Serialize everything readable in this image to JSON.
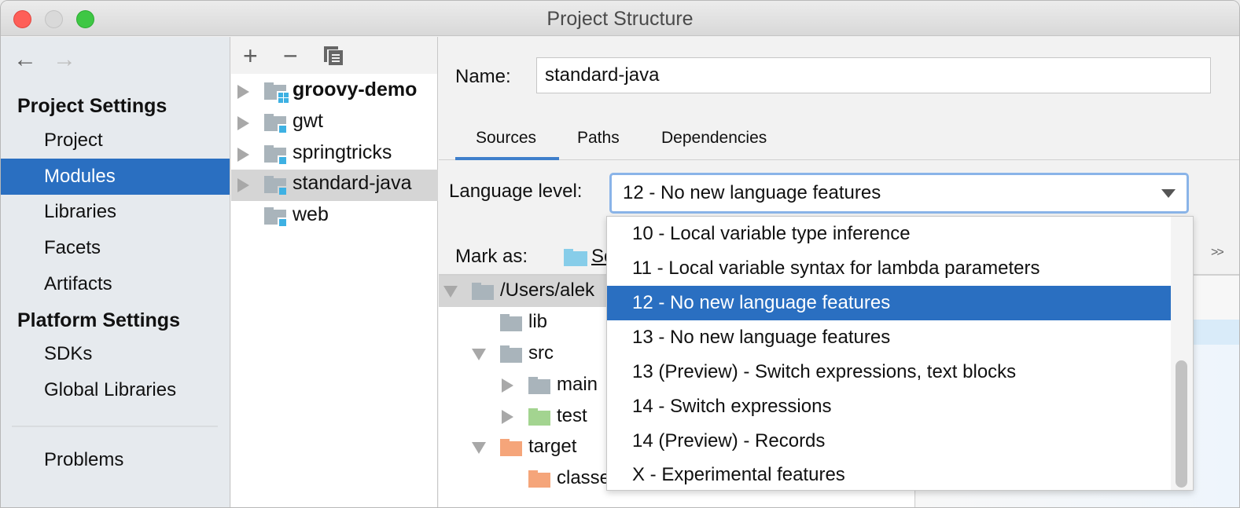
{
  "window": {
    "title": "Project Structure"
  },
  "sidebar": {
    "back_icon": "arrow-left-icon",
    "forward_icon": "arrow-right-icon",
    "sections": [
      {
        "heading": "Project Settings",
        "items": [
          {
            "label": "Project",
            "selected": false
          },
          {
            "label": "Modules",
            "selected": true
          },
          {
            "label": "Libraries",
            "selected": false
          },
          {
            "label": "Facets",
            "selected": false
          },
          {
            "label": "Artifacts",
            "selected": false
          }
        ]
      },
      {
        "heading": "Platform Settings",
        "items": [
          {
            "label": "SDKs",
            "selected": false
          },
          {
            "label": "Global Libraries",
            "selected": false
          }
        ]
      }
    ],
    "problems_label": "Problems"
  },
  "modules": {
    "toolbar": {
      "add": "+",
      "remove": "−",
      "copy_icon": "copy-icon"
    },
    "items": [
      {
        "name": "groovy-demo",
        "bold": true,
        "expandable": true,
        "selected": false
      },
      {
        "name": "gwt",
        "bold": false,
        "expandable": true,
        "selected": false
      },
      {
        "name": "springtricks",
        "bold": false,
        "expandable": true,
        "selected": false
      },
      {
        "name": "standard-java",
        "bold": false,
        "expandable": true,
        "selected": true
      },
      {
        "name": "web",
        "bold": false,
        "expandable": false,
        "selected": false
      }
    ]
  },
  "main": {
    "name_label": "Name:",
    "name_value": "standard-java",
    "tabs": [
      {
        "label": "Sources",
        "active": true
      },
      {
        "label": "Paths",
        "active": false
      },
      {
        "label": "Dependencies",
        "active": false
      }
    ],
    "language_level_label": "Language level:",
    "language_level_value": "12 - No new language features",
    "mark_as_label": "Mark as:",
    "mark_as_sources": "Sources",
    "more_icon": "double-chevron-right-icon",
    "tree": [
      {
        "label": "/Users/alek",
        "depth": 0,
        "expanded": true,
        "color": "#a9b4bb"
      },
      {
        "label": "lib",
        "depth": 1,
        "expanded": null,
        "color": "#a9b4bb"
      },
      {
        "label": "src",
        "depth": 1,
        "expanded": true,
        "color": "#a9b4bb"
      },
      {
        "label": "main",
        "depth": 2,
        "expanded": false,
        "color": "#a9b4bb"
      },
      {
        "label": "test",
        "depth": 2,
        "expanded": false,
        "color": "#a3d490"
      },
      {
        "label": "target",
        "depth": 1,
        "expanded": true,
        "color": "#f5a57a"
      },
      {
        "label": "classes",
        "depth": 2,
        "expanded": null,
        "color": "#f5a57a"
      }
    ]
  },
  "dropdown": {
    "options": [
      {
        "label": "10 - Local variable type inference",
        "selected": false
      },
      {
        "label": "11 - Local variable syntax for lambda parameters",
        "selected": false
      },
      {
        "label": "12 - No new language features",
        "selected": true
      },
      {
        "label": "13 - No new language features",
        "selected": false
      },
      {
        "label": "13 (Preview) - Switch expressions, text blocks",
        "selected": false
      },
      {
        "label": "14 - Switch expressions",
        "selected": false
      },
      {
        "label": "14 (Preview) - Records",
        "selected": false
      },
      {
        "label": "X - Experimental features",
        "selected": false
      }
    ]
  },
  "colors": {
    "selection": "#2a6fc1",
    "tab_underline": "#3f7fcb",
    "module_badge": "#3eb1e3"
  }
}
